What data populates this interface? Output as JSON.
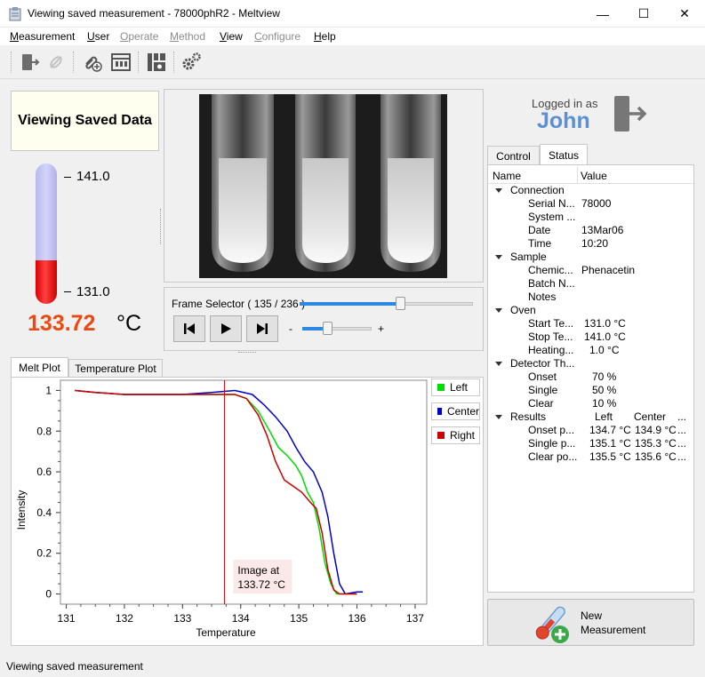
{
  "window": {
    "title": "Viewing saved measurement - 78000phR2 - Meltview",
    "min_glyph": "—",
    "max_glyph": "☐",
    "close_glyph": "✕"
  },
  "menu": [
    {
      "label": "Measurement",
      "underline": "M",
      "rest": "easurement",
      "enabled": true
    },
    {
      "label": "User",
      "underline": "U",
      "rest": "ser",
      "enabled": true
    },
    {
      "label": "Operate",
      "underline": "O",
      "rest": "perate",
      "enabled": false
    },
    {
      "label": "Method",
      "underline": "M",
      "rest": "ethod",
      "enabled": false
    },
    {
      "label": "View",
      "underline": "V",
      "rest": "iew",
      "enabled": true
    },
    {
      "label": "Configure",
      "underline": "C",
      "rest": "onfigure",
      "enabled": false
    },
    {
      "label": "Help",
      "underline": "H",
      "rest": "elp",
      "enabled": true
    }
  ],
  "toolbar_icons": [
    "logout-icon",
    "unlink-icon",
    "attach-add-icon",
    "display-icon",
    "camera-grid-icon",
    "settings-icon"
  ],
  "viewing_box": {
    "text": "Viewing Saved Data"
  },
  "thermometer": {
    "max_label": "141.0",
    "min_label": "131.0",
    "fill_fraction": 0.27
  },
  "temperature": {
    "value": "133.72",
    "unit": "°C"
  },
  "frame_selector": {
    "label": "Frame Selector ( 135 / 236 )",
    "current": 135,
    "total": 236,
    "zoom_minus": "-",
    "zoom_plus": "+"
  },
  "login": {
    "label": "Logged in as",
    "user": "John"
  },
  "tabs_right": [
    {
      "label": "Control"
    },
    {
      "label": "Status"
    }
  ],
  "status_table": {
    "headers": [
      "Name",
      "Value"
    ],
    "groups": [
      {
        "name": "Connection",
        "rows": [
          [
            "Serial N...",
            "78000"
          ],
          [
            "System ...",
            ""
          ],
          [
            "Date",
            "13Mar06"
          ],
          [
            "Time",
            "10:20"
          ]
        ]
      },
      {
        "name": "Sample",
        "rows": [
          [
            "Chemic...",
            "Phenacetin"
          ],
          [
            "Batch N...",
            ""
          ],
          [
            "Notes",
            ""
          ]
        ]
      },
      {
        "name": "Oven",
        "rows": [
          [
            "Start Te...",
            "131.0 °C"
          ],
          [
            "Stop Te...",
            "141.0 °C"
          ],
          [
            "Heating...",
            "1.0 °C"
          ]
        ]
      },
      {
        "name": "Detector Th...",
        "rows": [
          [
            "Onset",
            "70 %"
          ],
          [
            "Single",
            "50 %"
          ],
          [
            "Clear",
            "10 %"
          ]
        ]
      },
      {
        "name": "Results",
        "cols": [
          "Left",
          "Center",
          "..."
        ],
        "rows": [
          [
            "Onset p...",
            "134.7 °C",
            "134.9 °C",
            "..."
          ],
          [
            "Single p...",
            "135.1 °C",
            "135.3 °C",
            "..."
          ],
          [
            "Clear po...",
            "135.5 °C",
            "135.6 °C",
            "..."
          ]
        ]
      }
    ]
  },
  "new_measurement": {
    "line1": "New",
    "line2": "Measurement"
  },
  "plot_tabs": [
    {
      "label": "Melt Plot"
    },
    {
      "label": "Temperature Plot"
    }
  ],
  "chart_data": {
    "type": "line",
    "xlabel": "Temperature",
    "ylabel": "Intensity",
    "xlim": [
      130.9,
      137.2
    ],
    "ylim": [
      -0.05,
      1.05
    ],
    "xticks": [
      131,
      132,
      133,
      134,
      135,
      136,
      137
    ],
    "yticks": [
      0,
      0.2,
      0.4,
      0.6,
      0.8,
      1
    ],
    "ytick_labels": [
      "0",
      "0.2",
      "0.4",
      "0.6",
      "0.8",
      "1"
    ],
    "marker_x": 133.72,
    "annotation": {
      "line1": "Image at",
      "line2": "133.72 °C"
    },
    "legend": [
      {
        "name": "Left",
        "color": "#00dd00"
      },
      {
        "name": "Center",
        "color": "#0000cc"
      },
      {
        "name": "Right",
        "color": "#cc0000"
      }
    ],
    "series": [
      {
        "name": "Left",
        "color": "#00dd00",
        "x": [
          131.15,
          131.5,
          132.0,
          132.5,
          133.0,
          133.5,
          133.9,
          134.1,
          134.3,
          134.5,
          134.65,
          134.8,
          134.95,
          135.05,
          135.15,
          135.25,
          135.35,
          135.45,
          135.55,
          135.65,
          135.75,
          136.0
        ],
        "y": [
          1.0,
          0.99,
          0.98,
          0.98,
          0.98,
          0.98,
          0.98,
          0.96,
          0.9,
          0.8,
          0.72,
          0.68,
          0.63,
          0.58,
          0.5,
          0.45,
          0.32,
          0.15,
          0.05,
          0.0,
          0.0,
          0.0
        ]
      },
      {
        "name": "Center",
        "color": "#0000cc",
        "x": [
          131.15,
          131.5,
          132.0,
          132.5,
          133.0,
          133.5,
          133.9,
          134.2,
          134.4,
          134.6,
          134.8,
          134.95,
          135.1,
          135.25,
          135.4,
          135.5,
          135.6,
          135.7,
          135.8,
          136.0,
          136.1
        ],
        "y": [
          1.0,
          0.99,
          0.98,
          0.98,
          0.98,
          0.99,
          1.0,
          0.98,
          0.93,
          0.87,
          0.8,
          0.72,
          0.65,
          0.6,
          0.5,
          0.38,
          0.2,
          0.05,
          0.0,
          0.01,
          0.01
        ]
      },
      {
        "name": "Right",
        "color": "#cc0000",
        "x": [
          131.15,
          131.5,
          132.0,
          132.5,
          133.0,
          133.5,
          133.9,
          134.1,
          134.3,
          134.45,
          134.6,
          134.75,
          134.9,
          135.05,
          135.2,
          135.3,
          135.4,
          135.5,
          135.6,
          135.7,
          136.0
        ],
        "y": [
          1.0,
          0.99,
          0.98,
          0.98,
          0.98,
          0.98,
          0.98,
          0.96,
          0.88,
          0.78,
          0.65,
          0.56,
          0.53,
          0.5,
          0.45,
          0.42,
          0.3,
          0.12,
          0.02,
          0.0,
          0.0
        ]
      }
    ]
  },
  "status_bar": {
    "text": "Viewing saved measurement"
  }
}
